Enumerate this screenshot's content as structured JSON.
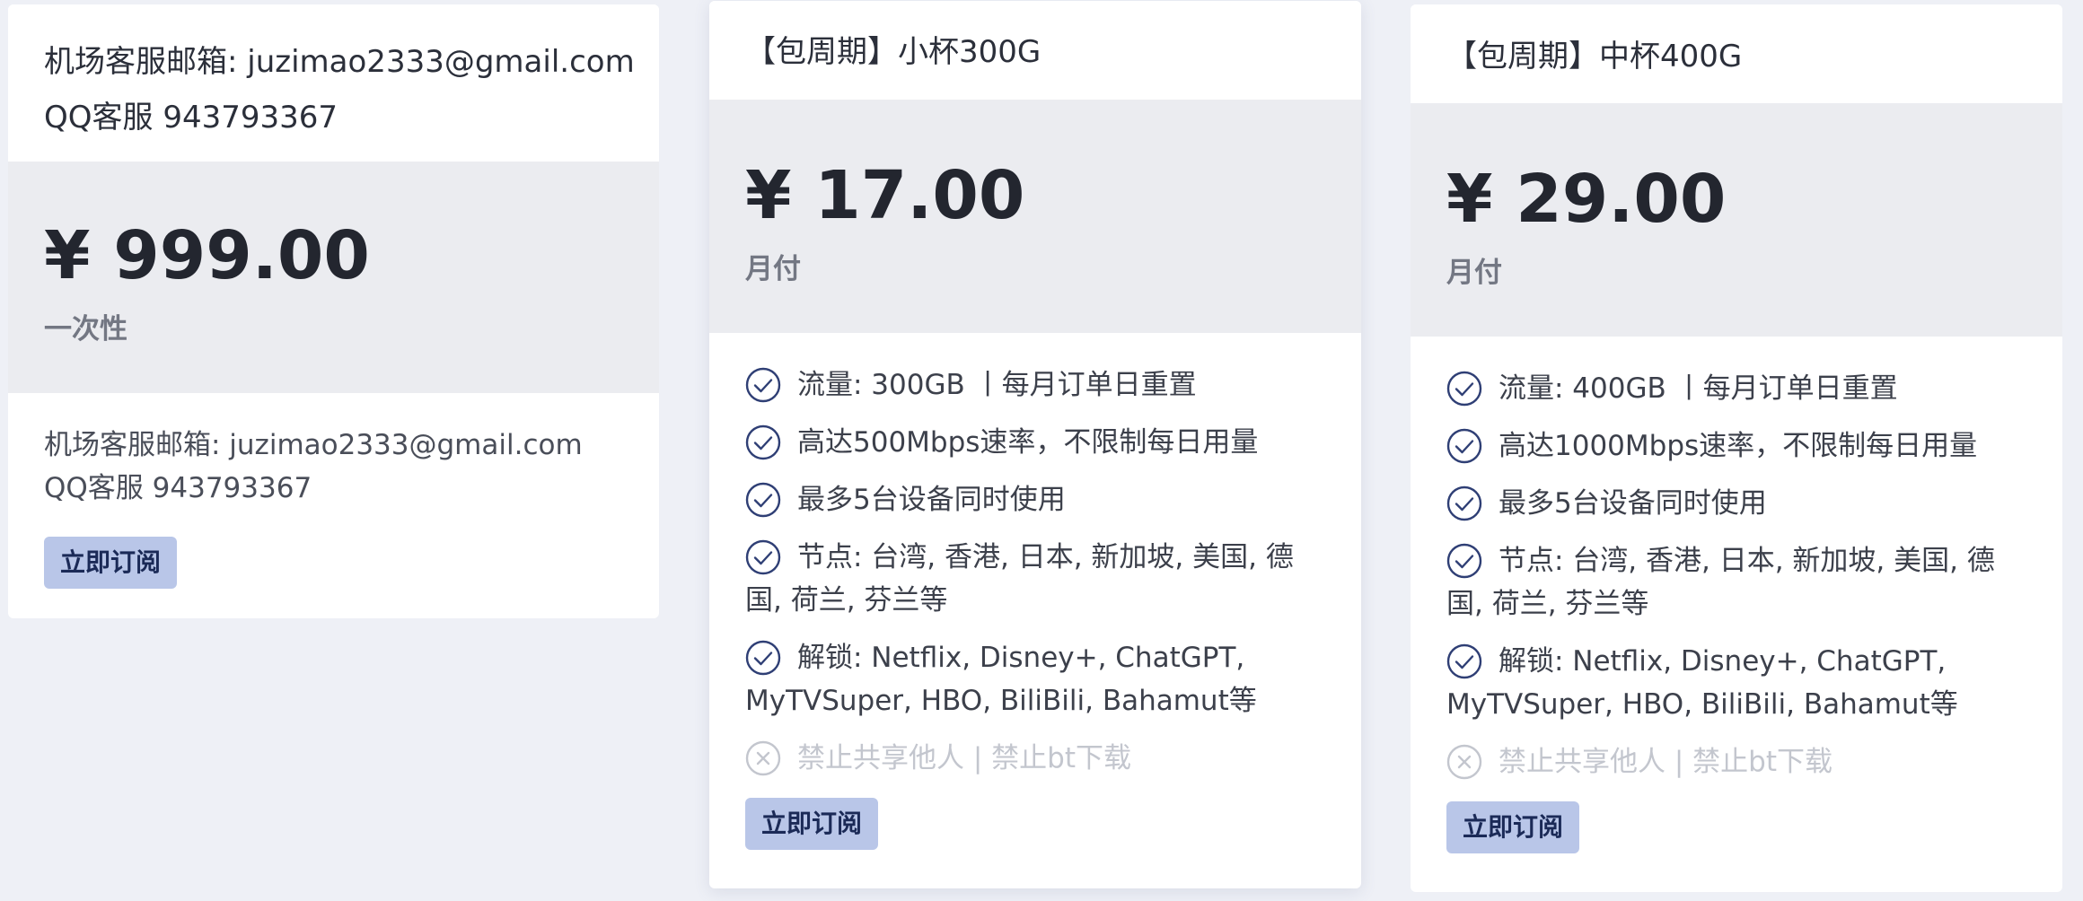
{
  "plans": [
    {
      "header_lines": [
        "机场客服邮箱: juzimao2333@gmail.com",
        "QQ客服 943793367"
      ],
      "price": "¥ 999.00",
      "period": "一次性",
      "description": "机场客服邮箱: juzimao2333@gmail.com QQ客服 943793367",
      "button_label": "立即订阅"
    },
    {
      "header_lines": [
        "【包周期】小杯300G"
      ],
      "price": "¥ 17.00",
      "period": "月付",
      "features": [
        {
          "text": "流量: 300GB 丨每月订单日重置",
          "enabled": true,
          "icon": "check-circle-icon"
        },
        {
          "text": "高达500Mbps速率，不限制每日用量",
          "enabled": true,
          "icon": "check-circle-icon"
        },
        {
          "text": "最多5台设备同时使用",
          "enabled": true,
          "icon": "check-circle-icon"
        },
        {
          "text": "节点: 台湾, 香港, 日本, 新加坡, 美国, 德国, 荷兰, 芬兰等",
          "enabled": true,
          "icon": "check-circle-icon"
        },
        {
          "text": "解锁: Netflix, Disney+, ChatGPT, MyTVSuper, HBO, BiliBili, Bahamut等",
          "enabled": true,
          "icon": "check-circle-icon"
        },
        {
          "text": "禁止共享他人 | 禁止bt下载",
          "enabled": false,
          "icon": "x-circle-icon"
        }
      ],
      "button_label": "立即订阅"
    },
    {
      "header_lines": [
        "【包周期】中杯400G"
      ],
      "price": "¥ 29.00",
      "period": "月付",
      "features": [
        {
          "text": "流量: 400GB 丨每月订单日重置",
          "enabled": true,
          "icon": "check-circle-icon"
        },
        {
          "text": "高达1000Mbps速率，不限制每日用量",
          "enabled": true,
          "icon": "check-circle-icon"
        },
        {
          "text": "最多5台设备同时使用",
          "enabled": true,
          "icon": "check-circle-icon"
        },
        {
          "text": "节点: 台湾, 香港, 日本, 新加坡, 美国, 德国, 荷兰, 芬兰等",
          "enabled": true,
          "icon": "check-circle-icon"
        },
        {
          "text": "解锁: Netflix, Disney+, ChatGPT, MyTVSuper, HBO, BiliBili, Bahamut等",
          "enabled": true,
          "icon": "check-circle-icon"
        },
        {
          "text": "禁止共享他人 | 禁止bt下载",
          "enabled": false,
          "icon": "x-circle-icon"
        }
      ],
      "button_label": "立即订阅"
    }
  ],
  "colors": {
    "page_bg": "#eef0f6",
    "card_bg": "#ffffff",
    "price_bg": "#ebecf0",
    "button_bg": "#b9c6e8",
    "button_text": "#1b2a57",
    "check_icon": "#2f3f75",
    "disabled": "#c3c6ce"
  }
}
